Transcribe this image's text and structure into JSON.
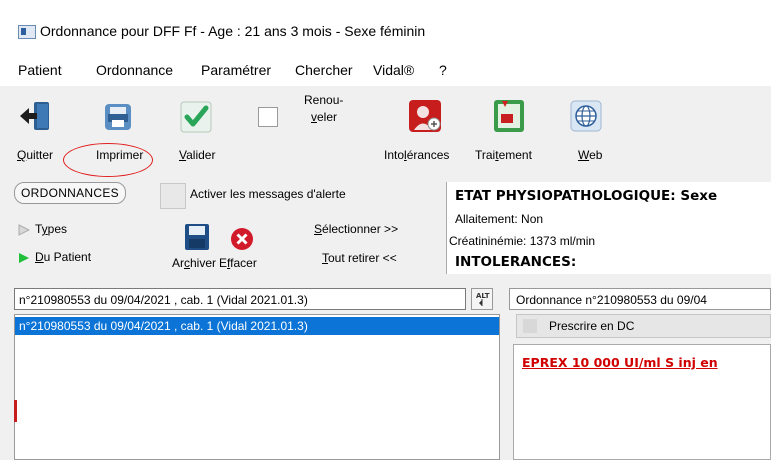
{
  "window": {
    "title": "Ordonnance pour DFF Ff - Age : 21 ans 3 mois - Sexe féminin"
  },
  "menu": [
    "Patient",
    "Ordonnance",
    "Paramétrer",
    "Chercher",
    "Vidal®",
    "?"
  ],
  "toolbar": {
    "quitter": "Quitter",
    "imprimer": "Imprimer",
    "valider": "Valider",
    "renouveler_line1": "Renou-",
    "renouveler_line2": "veler",
    "intolerances": "Intolérances",
    "traitement": "Traitement",
    "web": "Web"
  },
  "left": {
    "ordonnances_tab": "ORDONNANCES",
    "activer_label": "Activer les messages d'alerte",
    "types_label": "Types",
    "du_patient_label": "Du Patient",
    "archiver_label": "Archiver",
    "effacer_label": "Effacer",
    "selectionner_label": "Sélectionner >>",
    "tout_retirer_label": "Tout retirer <<",
    "combo_value": "n°210980553 du 09/04/2021 , cab. 1 (Vidal 2021.01.3)",
    "sort_label": "ALT",
    "list_items": [
      "n°210980553 du 09/04/2021 , cab. 1 (Vidal 2021.01.3)"
    ]
  },
  "etat": {
    "heading": "ETAT PHYSIOPATHOLOGIQUE: Sexe",
    "allaitement": "Allaitement: Non",
    "creatininemie": "Créatininémie: 1373 ml/min",
    "intolerances": "INTOLERANCES:"
  },
  "right": {
    "combo_value": "Ordonnance n°210980553 du 09/04",
    "prescrire_dc": "Prescrire en DC",
    "drug_line": "EPREX 10 000 UI/ml S inj en"
  },
  "colors": {
    "selection": "#0b74d6",
    "drug_red": "#d10000",
    "annotation_circle": "#e02020"
  }
}
